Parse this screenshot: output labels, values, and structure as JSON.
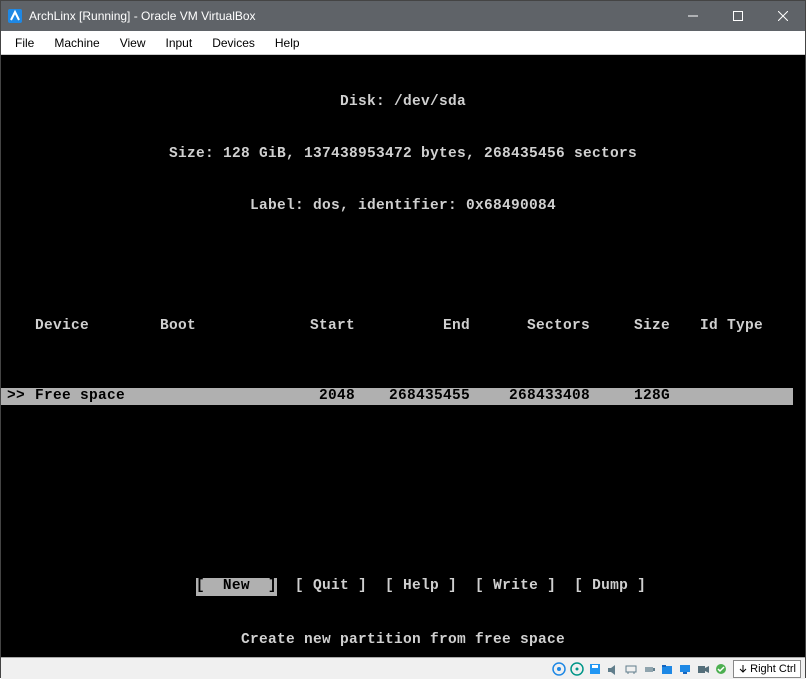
{
  "window": {
    "title": "ArchLinx [Running] - Oracle VM VirtualBox"
  },
  "menubar": [
    "File",
    "Machine",
    "View",
    "Input",
    "Devices",
    "Help"
  ],
  "terminal": {
    "disk_line": "Disk: /dev/sda",
    "size_line": "Size: 128 GiB, 137438953472 bytes, 268435456 sectors",
    "label_line": "Label: dos, identifier: 0x68490084",
    "columns": {
      "device": "Device",
      "boot": "Boot",
      "start": "Start",
      "end": "End",
      "sectors": "Sectors",
      "size": "Size",
      "idtype": "Id Type"
    },
    "row_prefix": ">>",
    "row": {
      "device": "Free space",
      "boot": "",
      "start": "2048",
      "end": "268435455",
      "sectors": "268433408",
      "size": "128G",
      "idtype": ""
    },
    "menu": {
      "lbr": "[",
      "rbr": "]",
      "new": "  New  ",
      "quit": " Quit ",
      "help": " Help ",
      "write": " Write ",
      "dump": " Dump "
    },
    "hint": "Create new partition from free space"
  },
  "statusbar": {
    "hostkey": "Right Ctrl"
  }
}
